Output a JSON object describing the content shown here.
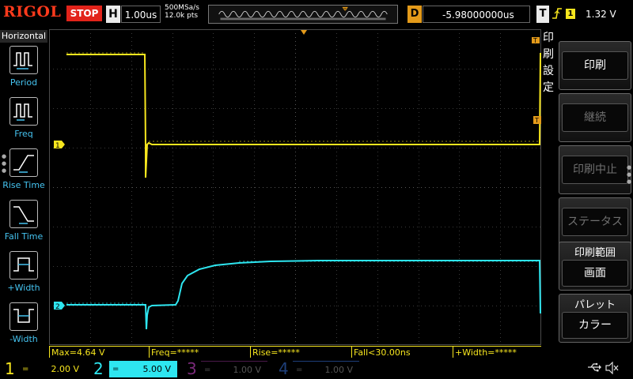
{
  "header": {
    "brand": "RIGOL",
    "run_state": "STOP",
    "horizontal": {
      "label": "H",
      "scale": "1.00us",
      "sample_rate": "500MSa/s",
      "points": "12.0k pts"
    },
    "delay": {
      "label": "D",
      "value": "-5.98000000us"
    },
    "trigger": {
      "label": "T",
      "edge_icon": "rising-edge-icon",
      "source": "1",
      "level": "1.32 V"
    }
  },
  "left_menu": {
    "title": "Horizontal",
    "items": [
      {
        "label": "Period",
        "icon": "period-icon"
      },
      {
        "label": "Freq",
        "icon": "frequency-icon"
      },
      {
        "label": "Rise Time",
        "icon": "rise-time-icon"
      },
      {
        "label": "Fall Time",
        "icon": "fall-time-icon"
      },
      {
        "label": "+Width",
        "icon": "positive-width-icon"
      },
      {
        "label": "-Width",
        "icon": "negative-width-icon"
      }
    ]
  },
  "right_menu": {
    "title": "印刷設定",
    "buttons": [
      {
        "label": "印刷",
        "enabled": true
      },
      {
        "label": "継続",
        "enabled": false
      },
      {
        "label": "印刷中止",
        "enabled": false
      },
      {
        "label": "ステータス",
        "enabled": false
      },
      {
        "head": "印刷範囲",
        "value": "画面"
      },
      {
        "head": "パレット",
        "value": "カラー"
      }
    ]
  },
  "markers": {
    "ch1": "1",
    "ch2": "2",
    "trigger_level": "T",
    "trigger_position": "T"
  },
  "measurements": [
    {
      "text": "Max=4.64 V"
    },
    {
      "text": "Freq=*****"
    },
    {
      "text": "Rise=*****"
    },
    {
      "text": "Fall<30.00ns"
    },
    {
      "text": "+Width=*****"
    }
  ],
  "channels": [
    {
      "number": "1",
      "coupling": "=",
      "scale": "2.00 V",
      "color": "#f7e61e",
      "active": true
    },
    {
      "number": "2",
      "coupling": "=",
      "scale": "5.00 V",
      "color": "#2ee6f0",
      "active": true
    },
    {
      "number": "3",
      "coupling": "=",
      "scale": "1.00 V",
      "color": "#c000c0",
      "active": false
    },
    {
      "number": "4",
      "coupling": "=",
      "scale": "1.00 V",
      "color": "#1a58d0",
      "active": false
    }
  ],
  "status_icons": [
    "usb-icon",
    "speaker-muted-icon"
  ],
  "colors": {
    "ch1": "#f7e61e",
    "ch2": "#2ee6f0",
    "trigger": "#e39a1a",
    "stop": "#e2231a",
    "menu_label": "#45c3f0"
  }
}
